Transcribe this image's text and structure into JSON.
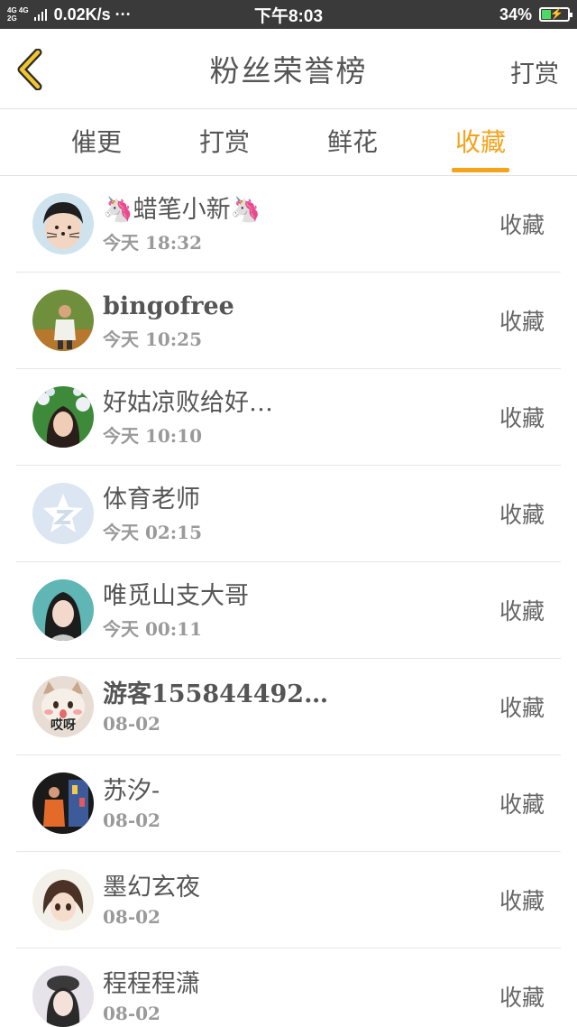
{
  "status_bar": {
    "net_top": "4G 4G",
    "net_bottom": "2G",
    "speed": "0.02K/s ···",
    "time": "下午8:03",
    "battery": "34%"
  },
  "header": {
    "title": "粉丝荣誉榜",
    "right_label": "打赏"
  },
  "tabs": [
    {
      "label": "催更"
    },
    {
      "label": "打赏"
    },
    {
      "label": "鲜花"
    },
    {
      "label": "收藏"
    }
  ],
  "active_tab": 3,
  "colors": {
    "accent": "#f5a31a",
    "text": "#555555",
    "subtext": "#9a9a9a",
    "status_bar": "#3a3a3a"
  },
  "items": [
    {
      "name": "🦄蜡笔小新🦄",
      "time": "今天 18:32",
      "action": "收藏",
      "avatar_icon": "boy-cat-whiskers-avatar"
    },
    {
      "name": "bingofree",
      "time": "今天 10:25",
      "action": "收藏",
      "avatar_icon": "man-outdoors-avatar"
    },
    {
      "name": "好姑凉败给好…",
      "time": "今天 10:10",
      "action": "收藏",
      "avatar_icon": "girl-flowers-avatar"
    },
    {
      "name": "体育老师",
      "time": "今天 02:15",
      "action": "收藏",
      "avatar_icon": "qzone-star-avatar"
    },
    {
      "name": "唯觅山支大哥",
      "time": "今天 00:11",
      "action": "收藏",
      "avatar_icon": "girl-portrait-avatar"
    },
    {
      "name": "游客155844492…",
      "time": "08-02",
      "action": "收藏",
      "avatar_icon": "cat-avatar",
      "avatar_text": "哎呀"
    },
    {
      "name": "苏汐-",
      "time": "08-02",
      "action": "收藏",
      "avatar_icon": "street-scene-avatar"
    },
    {
      "name": "墨幻玄夜",
      "time": "08-02",
      "action": "收藏",
      "avatar_icon": "anime-girl-avatar"
    },
    {
      "name": "程程程潇",
      "time": "08-02",
      "action": "收藏",
      "avatar_icon": "girl-hat-avatar"
    }
  ]
}
